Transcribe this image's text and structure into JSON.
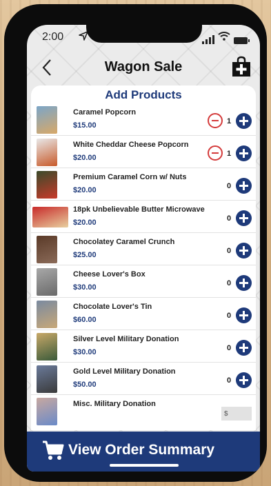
{
  "status_bar": {
    "time": "2:00"
  },
  "header": {
    "title": "Wagon Sale"
  },
  "section": {
    "title": "Add Products"
  },
  "products": [
    {
      "name": "Caramel Popcorn",
      "price": "$15.00",
      "qty": "1",
      "thumb": [
        "#7ba6c8",
        "#d8a868"
      ]
    },
    {
      "name": "White Cheddar Cheese Popcorn",
      "price": "$20.00",
      "qty": "1",
      "thumb": [
        "#e8e8e8",
        "#c85a2a"
      ]
    },
    {
      "name": "Premium Caramel Corn w/ Nuts",
      "price": "$20.00",
      "qty": "0",
      "thumb": [
        "#3a4a2a",
        "#c83a2a"
      ]
    },
    {
      "name": "18pk Unbelievable Butter Microwave",
      "price": "$20.00",
      "qty": "0",
      "thumb": [
        "#c82a2a",
        "#e8d0a0"
      ]
    },
    {
      "name": "Chocolatey Caramel Crunch",
      "price": "$25.00",
      "qty": "0",
      "thumb": [
        "#5a3a28",
        "#8a6a58"
      ]
    },
    {
      "name": "Cheese Lover's Box",
      "price": "$30.00",
      "qty": "0",
      "thumb": [
        "#a8a8a8",
        "#6a6a6a"
      ]
    },
    {
      "name": "Chocolate Lover's Tin",
      "price": "$60.00",
      "qty": "0",
      "thumb": [
        "#7a8aa0",
        "#c8a878"
      ]
    },
    {
      "name": "Silver Level Military Donation",
      "price": "$30.00",
      "qty": "0",
      "thumb": [
        "#c8a868",
        "#3a5a3a"
      ]
    },
    {
      "name": "Gold Level Military Donation",
      "price": "$50.00",
      "qty": "0",
      "thumb": [
        "#6a7a9a",
        "#3a3a3a"
      ]
    }
  ],
  "donation": {
    "name": "Misc. Military Donation",
    "placeholder": "$",
    "thumb": [
      "#c8a8a0",
      "#6a8ac8"
    ]
  },
  "summary_bar": {
    "label": "View Order Summary"
  },
  "colors": {
    "brand_navy": "#1e3a7a",
    "minus_red": "#d43a3a",
    "screen_bg": "#ebebeb"
  }
}
